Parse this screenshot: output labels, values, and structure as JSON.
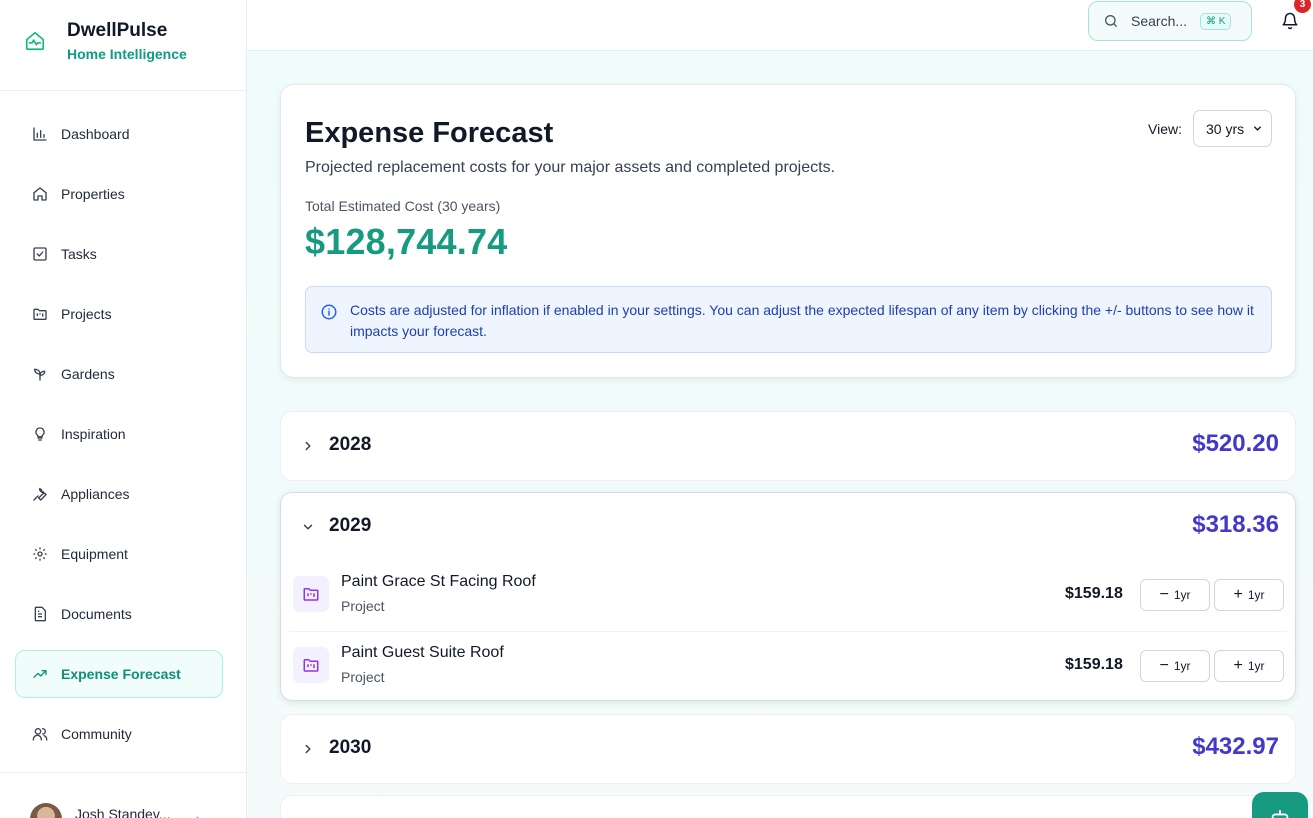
{
  "brand": {
    "title": "DwellPulse",
    "subtitle": "Home Intelligence"
  },
  "nav": {
    "items": [
      {
        "label": "Dashboard",
        "icon": "bar-chart-icon"
      },
      {
        "label": "Properties",
        "icon": "home-icon"
      },
      {
        "label": "Tasks",
        "icon": "check-square-icon"
      },
      {
        "label": "Projects",
        "icon": "folder-kanban-icon"
      },
      {
        "label": "Gardens",
        "icon": "sprout-icon"
      },
      {
        "label": "Inspiration",
        "icon": "lightbulb-icon"
      },
      {
        "label": "Appliances",
        "icon": "wrench-icon"
      },
      {
        "label": "Equipment",
        "icon": "gear-icon"
      },
      {
        "label": "Documents",
        "icon": "file-text-icon"
      },
      {
        "label": "Expense Forecast",
        "icon": "trending-up-icon",
        "active": true
      },
      {
        "label": "Community",
        "icon": "users-icon"
      }
    ]
  },
  "user": {
    "name": "Josh Standev..."
  },
  "topbar": {
    "search_placeholder": "Search...",
    "shortcut": "⌘ K",
    "notification_count": "3"
  },
  "forecast": {
    "title": "Expense Forecast",
    "subtitle": "Projected replacement costs for your major assets and completed projects.",
    "view_label": "View:",
    "view_value": "30 yrs",
    "total_label": "Total Estimated Cost (30 years)",
    "total_value": "$128,744.74",
    "info": "Costs are adjusted for inflation if enabled in your settings. You can adjust the expected lifespan of any item by clicking the +/- buttons to see how it impacts your forecast."
  },
  "years": [
    {
      "year": "2028",
      "amount": "$520.20",
      "expanded": false
    },
    {
      "year": "2029",
      "amount": "$318.36",
      "expanded": true,
      "items": [
        {
          "title": "Paint Grace St Facing Roof",
          "type": "Project",
          "cost": "$159.18",
          "minus_label": "1yr",
          "plus_label": "1yr"
        },
        {
          "title": "Paint Guest Suite Roof",
          "type": "Project",
          "cost": "$159.18",
          "minus_label": "1yr",
          "plus_label": "1yr"
        }
      ]
    },
    {
      "year": "2030",
      "amount": "$432.97",
      "expanded": false
    }
  ],
  "colors": {
    "accent": "#169a80",
    "amount": "#4338ca",
    "info_text": "#1e40af",
    "badge": "#dc2626"
  }
}
